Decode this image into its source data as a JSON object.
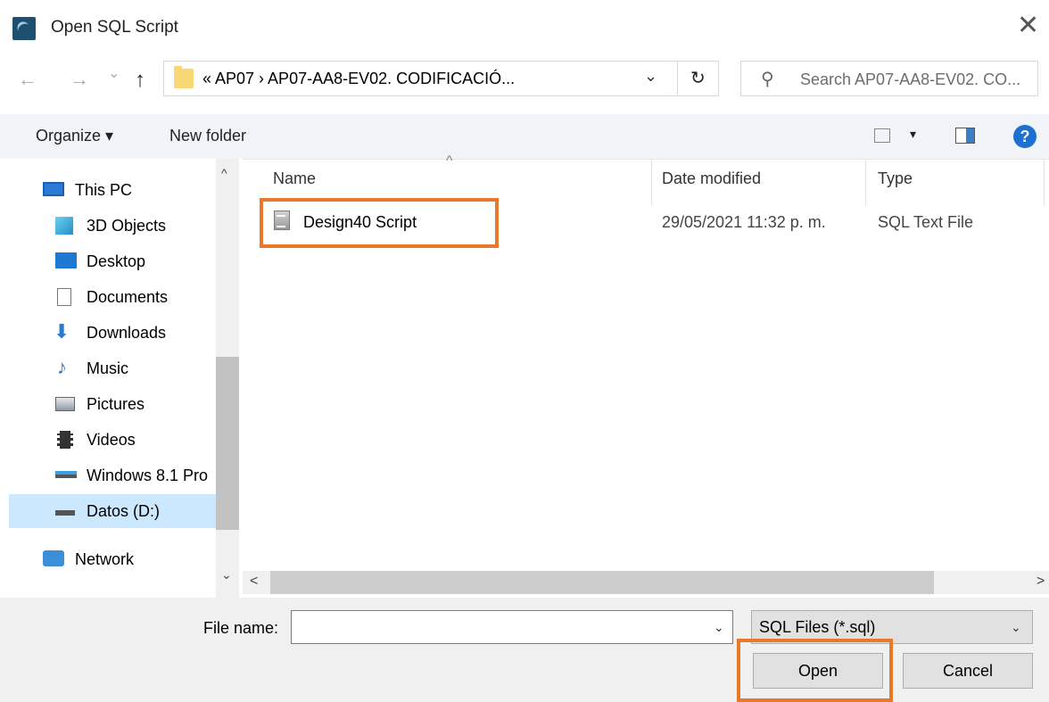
{
  "window": {
    "title": "Open SQL Script",
    "close_glyph": "✕"
  },
  "nav": {
    "back": "←",
    "forward": "→",
    "recent": "⌄",
    "up": "↑",
    "address": "«  AP07  ›  AP07-AA8-EV02. CODIFICACIÓ...",
    "address_dropdown": "⌄",
    "refresh": "↻",
    "search_placeholder": "Search AP07-AA8-EV02. CO..."
  },
  "toolbar": {
    "organize": "Organize ▾",
    "new_folder": "New folder",
    "view_arrow": "▾",
    "help": "?"
  },
  "sidebar": {
    "items": [
      {
        "label": "This PC",
        "icon": "pc-icon"
      },
      {
        "label": "3D Objects",
        "icon": "cube-icon"
      },
      {
        "label": "Desktop",
        "icon": "desktop-icon"
      },
      {
        "label": "Documents",
        "icon": "documents-icon"
      },
      {
        "label": "Downloads",
        "icon": "download-icon"
      },
      {
        "label": "Music",
        "icon": "music-icon"
      },
      {
        "label": "Pictures",
        "icon": "pictures-icon"
      },
      {
        "label": "Videos",
        "icon": "videos-icon"
      },
      {
        "label": "Windows 8.1 Pro",
        "icon": "drive-icon"
      },
      {
        "label": "Datos (D:)",
        "icon": "drive-icon"
      },
      {
        "label": "Network",
        "icon": "network-icon"
      }
    ],
    "selected": "Datos (D:)"
  },
  "columns": {
    "name": "Name",
    "date_modified": "Date modified",
    "type": "Type"
  },
  "files": [
    {
      "name": "Design40 Script",
      "date_modified": "29/05/2021 11:32 p. m.",
      "type": "SQL Text File"
    }
  ],
  "scroll": {
    "up": "^",
    "down": "⌄",
    "left": "<",
    "right": ">"
  },
  "footer": {
    "file_name_label": "File name:",
    "file_name_value": "",
    "filter": "SQL Files (*.sql)",
    "open_button": "Open",
    "cancel_button": "Cancel"
  },
  "colors": {
    "highlight": "#e8792c",
    "selected_bg": "#cce8ff",
    "toolbar_bg": "#f0f4f9"
  }
}
